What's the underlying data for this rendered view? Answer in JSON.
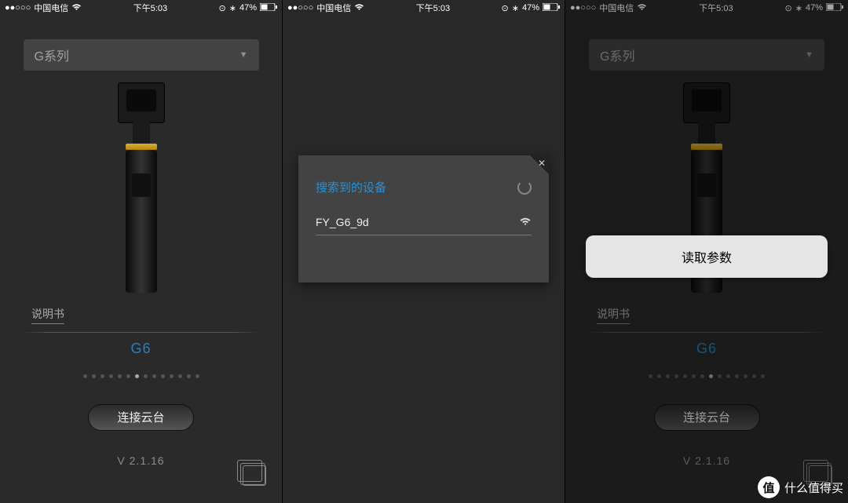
{
  "status": {
    "carrier": "中国电信",
    "time": "下午5:03",
    "battery": "47%"
  },
  "dropdown": {
    "label": "G系列"
  },
  "manual": {
    "label": "说明书"
  },
  "model": "G6",
  "connect": "连接云台",
  "version": "V 2.1.16",
  "modal": {
    "title": "搜索到的设备",
    "device": "FY_G6_9d"
  },
  "toast": "读取参数",
  "watermark": {
    "badge": "值",
    "text": "什么值得买"
  }
}
